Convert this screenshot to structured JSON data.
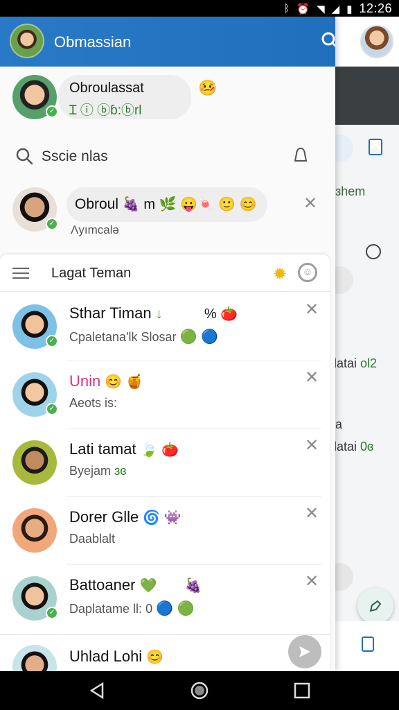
{
  "status_bar": {
    "time": "12:26",
    "icons": [
      "bluetooth-icon",
      "alarm-icon",
      "wifi-icon",
      "signal-icon",
      "battery-icon"
    ]
  },
  "colors": {
    "app_bar": "#2979c6",
    "online_badge": "#4caf50",
    "nav_bar": "#000000"
  },
  "app_bar": {
    "title": "Obmassian"
  },
  "profile": {
    "name": "Obroulassat",
    "status": "Ɪ ⓘ  ⓑɓ:ⓑrl"
  },
  "search": {
    "placeholder": "Sscie nlas"
  },
  "featured": {
    "text": "Obroul",
    "sub": "Ʌyımcalǝ"
  },
  "friends_panel": {
    "title": "Lagat Teman"
  },
  "friends": [
    {
      "name": "Sthar Timan",
      "sub": "Cpaletana'lk Slosar",
      "emoji_after_name": "↓",
      "extra": "% 🍅"
    },
    {
      "name": "Unin",
      "sub": "Aeots is:",
      "emoji_after_name": "😊 🍯",
      "extra": ""
    },
    {
      "name": "Lati tamat",
      "sub": "Byejam",
      "sub_extra": "ɜɞ",
      "emoji_after_name": "🍃 🍅",
      "extra": ""
    },
    {
      "name": "Dorer Glle",
      "sub": "Daablalt",
      "emoji_after_name": "🌀 👾",
      "extra": ""
    },
    {
      "name": "Battoaner",
      "sub": "Daplatame ll:",
      "sub_extra": "0",
      "emoji_after_name": "💚",
      "extra": "🍇"
    },
    {
      "name": "Uhlad Lohi",
      "sub": "",
      "emoji_after_name": "😊",
      "extra": ""
    }
  ],
  "background_app": {
    "items": [
      "ɜhem",
      "latai",
      "ol2",
      "a",
      "latai",
      "0ɞ"
    ]
  }
}
